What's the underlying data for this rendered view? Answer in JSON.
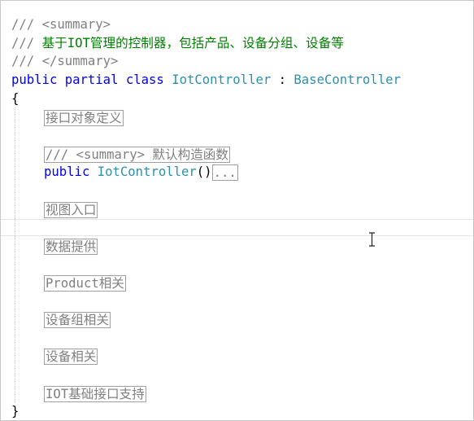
{
  "summary_open": {
    "prefix": "/// ",
    "tag": "<summary>"
  },
  "summary_text": {
    "prefix": "/// ",
    "text": "基于IOT管理的控制器，包括产品、设备分组、设备等"
  },
  "summary_close": {
    "prefix": "/// ",
    "tag": "</summary>"
  },
  "class_decl": {
    "public": "public",
    "partial": "partial",
    "class": "class",
    "name": "IotController",
    "colon": " : ",
    "base": "BaseController"
  },
  "open_brace": "{",
  "close_brace": "}",
  "regions": {
    "interface_def": "接口对象定义",
    "ctor_summary": "/// <summary> 默认构造函数",
    "view_entry": "视图入口",
    "data_provider": "数据提供",
    "product": "Product相关",
    "device_group": "设备组相关",
    "device": "设备相关",
    "iot_base": "IOT基础接口支持"
  },
  "ctor": {
    "public": "public",
    "name": "IotController",
    "parens": "()",
    "ellipsis": "..."
  },
  "colors": {
    "comment": "#008000",
    "xml_tag": "#808080",
    "keyword": "#0000ff",
    "type": "#2b91af",
    "collapsed_border": "#a0a0a0"
  },
  "icons": {
    "cursor": "ibeam-cursor-icon"
  }
}
